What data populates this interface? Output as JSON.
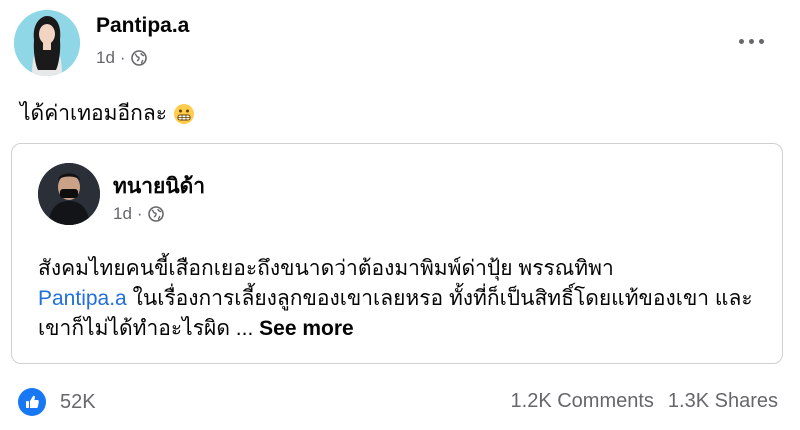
{
  "post": {
    "author": "Pantipa.a",
    "time": "1d",
    "separator": "·",
    "text": "ได้ค่าเทอมอีกละ",
    "emoji_icon": "grimacing-face-emoji"
  },
  "shared": {
    "author": "ทนายนิด้า",
    "time": "1d",
    "separator": "·",
    "body_part1": "สังคมไทยคนขี้เสือกเยอะถึงขนาดว่าต้องมาพิมพ์ด่าปุ้ย พรรณทิพา",
    "mention": "Pantipa.a",
    "body_part2": " ในเรื่องการเลี้ยงลูกของเขาเลยหรอ ทั้งที่ก็เป็นสิทธิ์โดยแท้ของเขา และเขาก็ไม่ได้ทำอะไรผิด ... ",
    "see_more": "See more"
  },
  "footer": {
    "likes": "52K",
    "comments": "1.2K Comments",
    "shares": "1.3K Shares"
  },
  "colors": {
    "accent": "#1877f2",
    "mention": "#216fdb",
    "muted": "#65676b",
    "border": "#ced0d4"
  }
}
